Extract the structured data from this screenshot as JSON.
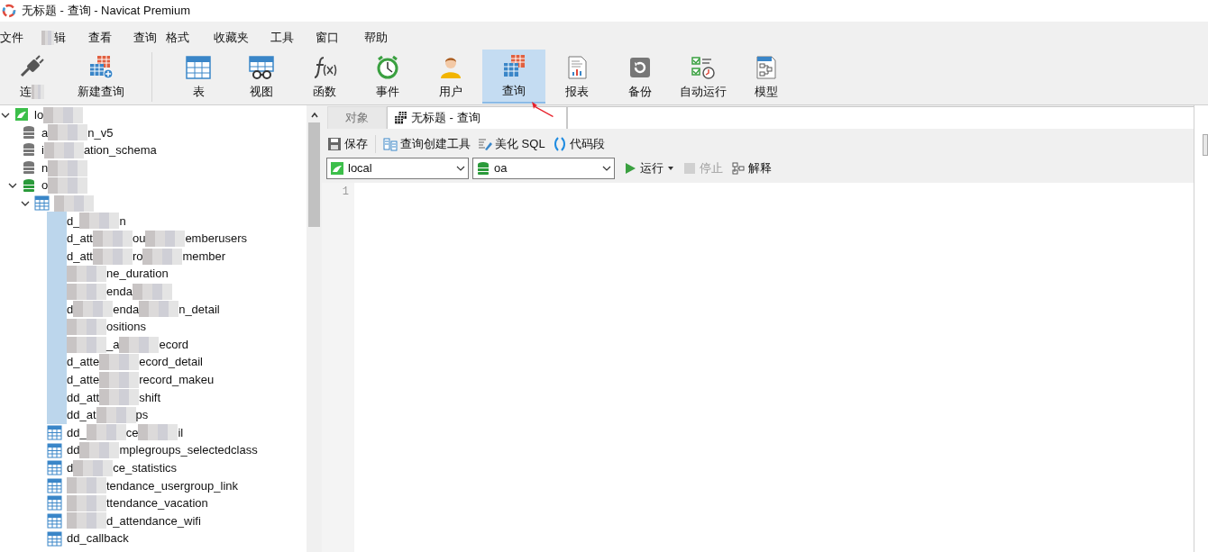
{
  "window": {
    "title": "无标题 - 查询 - Navicat Premium"
  },
  "menu": [
    {
      "label": "文件",
      "blurred": false
    },
    {
      "label": "辑",
      "blurred": true
    },
    {
      "label": "查看",
      "blurred": false
    },
    {
      "label": "查询",
      "blurred": false
    },
    {
      "label": "格式",
      "blurred": false
    },
    {
      "label": "收藏夹",
      "blurred": false
    },
    {
      "label": "工具",
      "blurred": false
    },
    {
      "label": "窗口",
      "blurred": false
    },
    {
      "label": "帮助",
      "blurred": false
    }
  ],
  "toolbar": [
    {
      "kind": "connect",
      "label": "连",
      "selected": false,
      "blurred": true
    },
    {
      "kind": "newquery",
      "label": "新建查询",
      "selected": false,
      "blurred": false
    },
    {
      "kind": "table",
      "label": "表",
      "selected": false,
      "blurred": false
    },
    {
      "kind": "view",
      "label": "视图",
      "selected": false,
      "blurred": false
    },
    {
      "kind": "function",
      "label": "函数",
      "selected": false,
      "blurred": false
    },
    {
      "kind": "event",
      "label": "事件",
      "selected": false,
      "blurred": false
    },
    {
      "kind": "user",
      "label": "用户",
      "selected": false,
      "blurred": false
    },
    {
      "kind": "query",
      "label": "查询",
      "selected": true,
      "blurred": false
    },
    {
      "kind": "report",
      "label": "报表",
      "selected": false,
      "blurred": false
    },
    {
      "kind": "backup",
      "label": "备份",
      "selected": false,
      "blurred": false
    },
    {
      "kind": "schedule",
      "label": "自动运行",
      "selected": false,
      "blurred": false
    },
    {
      "kind": "model",
      "label": "模型",
      "selected": false,
      "blurred": false
    }
  ],
  "tree": [
    {
      "kind": "connection",
      "expanded": true,
      "segments": [
        {
          "kind": "text",
          "text": "lo"
        },
        {
          "kind": "blur"
        }
      ],
      "children": [
        {
          "kind": "database",
          "active": false,
          "segments": [
            {
              "kind": "text",
              "text": "a"
            },
            {
              "kind": "blur"
            },
            {
              "kind": "text",
              "text": "n_v5"
            }
          ]
        },
        {
          "kind": "database",
          "active": false,
          "segments": [
            {
              "kind": "text",
              "text": "i"
            },
            {
              "kind": "blur"
            },
            {
              "kind": "text",
              "text": "ation_schema"
            }
          ]
        },
        {
          "kind": "database",
          "active": false,
          "segments": [
            {
              "kind": "text",
              "text": "n"
            },
            {
              "kind": "blur"
            }
          ]
        },
        {
          "kind": "database",
          "active": true,
          "expanded": true,
          "segments": [
            {
              "kind": "text",
              "text": "o"
            },
            {
              "kind": "blur"
            }
          ],
          "children": [
            {
              "kind": "tables",
              "expanded": true,
              "segments": [
                {
                  "kind": "blur"
                }
              ],
              "children": [
                {
                  "kind": "table",
                  "icon_blurred": true,
                  "segments": [
                    {
                      "kind": "text",
                      "text": "d_"
                    },
                    {
                      "kind": "blur"
                    },
                    {
                      "kind": "text",
                      "text": "n"
                    }
                  ]
                },
                {
                  "kind": "table",
                  "icon_blurred": true,
                  "segments": [
                    {
                      "kind": "text",
                      "text": "d_att"
                    },
                    {
                      "kind": "blur"
                    },
                    {
                      "kind": "text",
                      "text": "ou"
                    },
                    {
                      "kind": "blur"
                    },
                    {
                      "kind": "text",
                      "text": "emberusers"
                    }
                  ]
                },
                {
                  "kind": "table",
                  "icon_blurred": true,
                  "segments": [
                    {
                      "kind": "text",
                      "text": "d_att"
                    },
                    {
                      "kind": "blur"
                    },
                    {
                      "kind": "text",
                      "text": "ro"
                    },
                    {
                      "kind": "blur"
                    },
                    {
                      "kind": "text",
                      "text": "member"
                    }
                  ]
                },
                {
                  "kind": "table",
                  "icon_blurred": true,
                  "segments": [
                    {
                      "kind": "blur"
                    },
                    {
                      "kind": "text",
                      "text": "ne_duration"
                    }
                  ]
                },
                {
                  "kind": "table",
                  "icon_blurred": true,
                  "segments": [
                    {
                      "kind": "blur"
                    },
                    {
                      "kind": "text",
                      "text": "enda"
                    },
                    {
                      "kind": "blur"
                    }
                  ]
                },
                {
                  "kind": "table",
                  "icon_blurred": true,
                  "segments": [
                    {
                      "kind": "text",
                      "text": "d"
                    },
                    {
                      "kind": "blur"
                    },
                    {
                      "kind": "text",
                      "text": "enda"
                    },
                    {
                      "kind": "blur"
                    },
                    {
                      "kind": "text",
                      "text": "n_detail"
                    }
                  ]
                },
                {
                  "kind": "table",
                  "icon_blurred": true,
                  "segments": [
                    {
                      "kind": "blur"
                    },
                    {
                      "kind": "text",
                      "text": "ositions"
                    }
                  ]
                },
                {
                  "kind": "table",
                  "icon_blurred": true,
                  "segments": [
                    {
                      "kind": "blur"
                    },
                    {
                      "kind": "text",
                      "text": "_a"
                    },
                    {
                      "kind": "blur"
                    },
                    {
                      "kind": "text",
                      "text": "ecord"
                    }
                  ]
                },
                {
                  "kind": "table",
                  "icon_blurred": true,
                  "segments": [
                    {
                      "kind": "text",
                      "text": "d_atte"
                    },
                    {
                      "kind": "blur"
                    },
                    {
                      "kind": "text",
                      "text": "ecord_detail"
                    }
                  ]
                },
                {
                  "kind": "table",
                  "icon_blurred": true,
                  "segments": [
                    {
                      "kind": "text",
                      "text": "d_atte"
                    },
                    {
                      "kind": "blur"
                    },
                    {
                      "kind": "text",
                      "text": "record_makeu"
                    }
                  ]
                },
                {
                  "kind": "table",
                  "icon_blurred": true,
                  "segments": [
                    {
                      "kind": "text",
                      "text": "dd_att"
                    },
                    {
                      "kind": "blur"
                    },
                    {
                      "kind": "text",
                      "text": "shift"
                    }
                  ]
                },
                {
                  "kind": "table",
                  "icon_blurred": true,
                  "segments": [
                    {
                      "kind": "text",
                      "text": "dd_at"
                    },
                    {
                      "kind": "blur"
                    },
                    {
                      "kind": "text",
                      "text": "ps"
                    }
                  ]
                },
                {
                  "kind": "table",
                  "icon_blurred": false,
                  "segments": [
                    {
                      "kind": "text",
                      "text": "dd_"
                    },
                    {
                      "kind": "blur"
                    },
                    {
                      "kind": "text",
                      "text": "ce"
                    },
                    {
                      "kind": "blur"
                    },
                    {
                      "kind": "text",
                      "text": "il"
                    }
                  ]
                },
                {
                  "kind": "table",
                  "icon_blurred": false,
                  "segments": [
                    {
                      "kind": "text",
                      "text": "dd"
                    },
                    {
                      "kind": "blur"
                    },
                    {
                      "kind": "text",
                      "text": "mplegroups_selectedclass"
                    }
                  ]
                },
                {
                  "kind": "table",
                  "icon_blurred": false,
                  "segments": [
                    {
                      "kind": "text",
                      "text": "d"
                    },
                    {
                      "kind": "blur"
                    },
                    {
                      "kind": "text",
                      "text": "ce_statistics"
                    }
                  ]
                },
                {
                  "kind": "table",
                  "icon_blurred": false,
                  "segments": [
                    {
                      "kind": "blur"
                    },
                    {
                      "kind": "text",
                      "text": "tendance_usergroup_link"
                    }
                  ]
                },
                {
                  "kind": "table",
                  "icon_blurred": false,
                  "segments": [
                    {
                      "kind": "blur"
                    },
                    {
                      "kind": "text",
                      "text": "ttendance_vacation"
                    }
                  ]
                },
                {
                  "kind": "table",
                  "icon_blurred": false,
                  "segments": [
                    {
                      "kind": "blur"
                    },
                    {
                      "kind": "text",
                      "text": "d_attendance_wifi"
                    }
                  ]
                },
                {
                  "kind": "table",
                  "icon_blurred": false,
                  "segments": [
                    {
                      "kind": "text",
                      "text": "dd_callback"
                    }
                  ]
                }
              ]
            }
          ]
        }
      ]
    }
  ],
  "tabs": [
    {
      "label": "对象",
      "selected": false,
      "icon": false
    },
    {
      "label": "无标题 - 查询",
      "selected": true,
      "icon": true
    }
  ],
  "query_toolbar": [
    {
      "kind": "save",
      "label": "保存"
    },
    {
      "kind": "builder",
      "label": "查询创建工具"
    },
    {
      "kind": "beautify",
      "label": "美化 SQL"
    },
    {
      "kind": "snippet",
      "label": "代码段"
    }
  ],
  "connection_select": {
    "value": "local"
  },
  "database_select": {
    "value": "oa"
  },
  "run_button": {
    "label": "运行",
    "disabled": false
  },
  "stop_button": {
    "label": "停止",
    "disabled": true
  },
  "explain_button": {
    "label": "解释",
    "disabled": false
  },
  "editor": {
    "line_numbers": [
      "1"
    ]
  }
}
